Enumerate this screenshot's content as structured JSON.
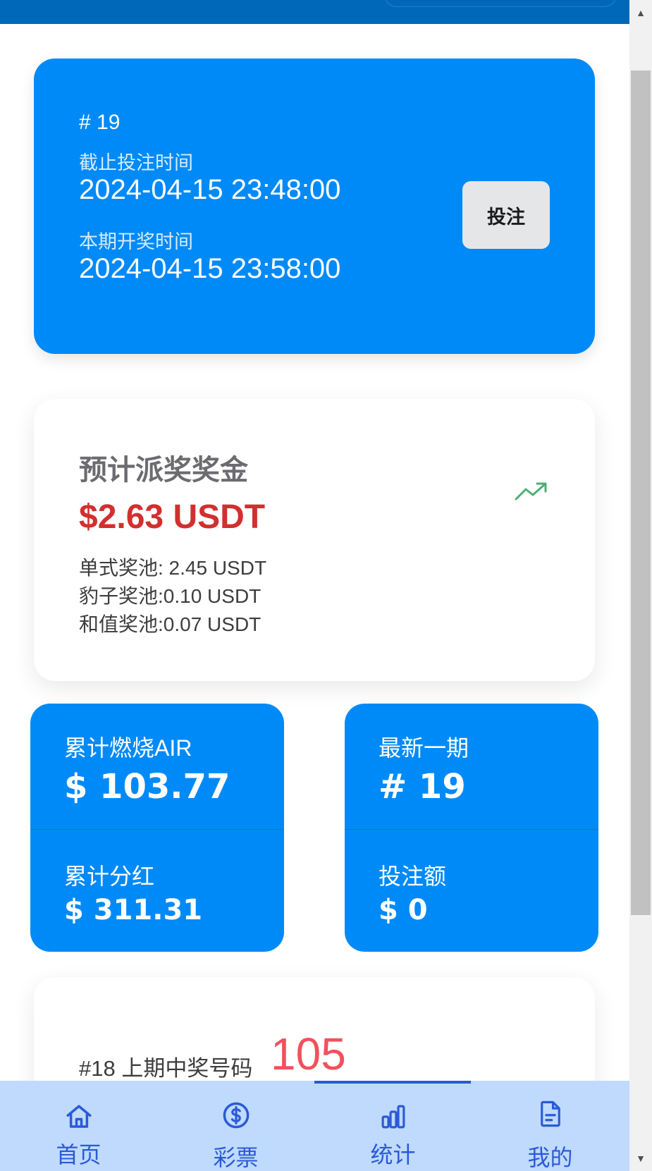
{
  "issue_card": {
    "issue_no": "# 19",
    "deadline_label": "截止投注时间",
    "deadline_value": "2024-04-15 23:48:00",
    "draw_label": "本期开奖时间",
    "draw_value": "2024-04-15 23:58:00",
    "bet_button": "投注"
  },
  "prize_card": {
    "title": "预计派奖奖金",
    "amount": "$2.63 USDT",
    "pools": [
      "单式奖池: 2.45 USDT",
      "豹子奖池:0.10 USDT",
      "和值奖池:0.07 USDT"
    ],
    "trend_icon": "trending-up-icon",
    "trend_color": "#4caf73"
  },
  "stats": {
    "burn_label": "累计燃烧AIR",
    "burn_value": "$ 103.77",
    "dividend_label": "累计分红",
    "dividend_value": "$ 311.31",
    "latest_label": "最新一期",
    "latest_value": "# 19",
    "bet_amount_label": "投注额",
    "bet_amount_value": "$ 0"
  },
  "last_draw": {
    "label": "#18 上期中奖号码",
    "number": "105"
  },
  "bottom_nav": {
    "items": [
      {
        "label": "首页",
        "icon": "home-icon"
      },
      {
        "label": "彩票",
        "icon": "dollar-coin-icon"
      },
      {
        "label": "统计",
        "icon": "bar-chart-icon",
        "active": true
      },
      {
        "label": "我的",
        "icon": "document-icon"
      }
    ]
  },
  "colors": {
    "primary": "#008af7",
    "topbar": "#0068b8",
    "prize_red": "#d22f2f",
    "last_number": "#f0525d",
    "nav_bg": "#bfdafc",
    "nav_text": "#2b5ad6"
  }
}
